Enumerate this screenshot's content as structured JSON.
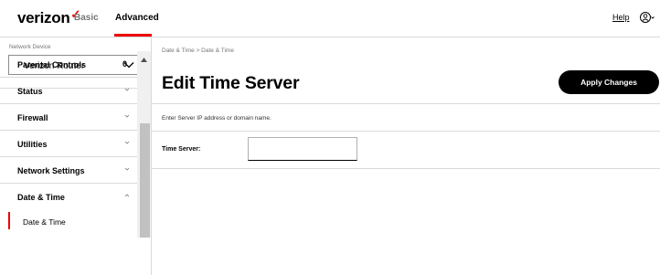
{
  "header": {
    "logo": "verizon",
    "logo_mark": "✓",
    "tabs": [
      {
        "label": "Basic",
        "active": false
      },
      {
        "label": "Advanced",
        "active": true
      }
    ],
    "help_label": "Help",
    "user_icon": "user-icon"
  },
  "sidebar": {
    "device_label": "Network Device",
    "device_selected": "Verizon Router",
    "items": [
      {
        "label": "Parental Controls",
        "indicator": "0"
      },
      {
        "label": "Status",
        "icon": "chevron-down-icon"
      },
      {
        "label": "Firewall",
        "icon": "chevron-down-icon"
      },
      {
        "label": "Utilities",
        "icon": "chevron-down-icon"
      },
      {
        "label": "Network Settings",
        "icon": "chevron-down-icon"
      },
      {
        "label": "Date & Time",
        "icon": "chevron-up-icon",
        "expanded": true
      }
    ],
    "subitems": [
      {
        "label": "Date & Time",
        "active": true
      }
    ]
  },
  "main": {
    "breadcrumb": "Date & Time  >  Date & Time",
    "title": "Edit Time Server",
    "apply_button": "Apply Changes",
    "instructions": "Enter Server IP address or domain name.",
    "time_server_label": "Time Server:",
    "time_server_value": "",
    "time_server_placeholder": ""
  },
  "colors": {
    "brand_red": "#ee0000",
    "divider": "#d8dada",
    "button_bg": "#000000"
  }
}
